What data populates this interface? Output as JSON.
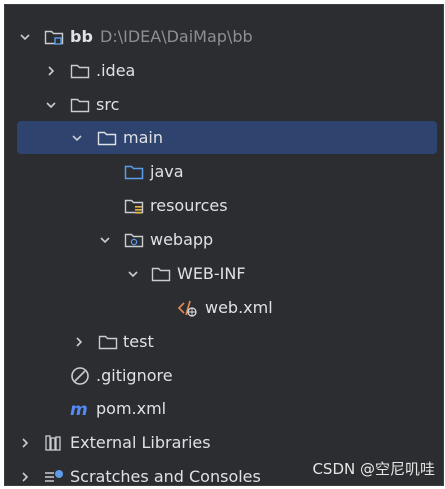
{
  "tree": {
    "root": {
      "label": "bb",
      "path": "D:\\IDEA\\DaiMap\\bb"
    },
    "idea": {
      "label": ".idea"
    },
    "src": {
      "label": "src"
    },
    "main": {
      "label": "main"
    },
    "java": {
      "label": "java"
    },
    "resources": {
      "label": "resources"
    },
    "webapp": {
      "label": "webapp"
    },
    "webinf": {
      "label": "WEB-INF"
    },
    "webxml": {
      "label": "web.xml"
    },
    "test": {
      "label": "test"
    },
    "gitignore": {
      "label": ".gitignore"
    },
    "pom": {
      "label": "pom.xml"
    },
    "external": {
      "label": "External Libraries"
    },
    "scratches": {
      "label": "Scratches and Consoles"
    }
  },
  "watermark": "CSDN @空尼叽哇",
  "colors": {
    "panel_bg": "#2b2d30",
    "selection": "#2e436e",
    "text": "#dfe1e5",
    "muted": "#8c8f94",
    "source_folder": "#5c9ceb",
    "maven_blue": "#548af7",
    "xml_orange": "#e08855"
  },
  "icons": {
    "folder": "folder-icon",
    "project": "project-folder-icon",
    "source": "source-folder-icon",
    "resources": "resources-folder-icon",
    "web": "web-folder-icon",
    "xml": "xml-file-icon",
    "ignore": "ignore-file-icon",
    "maven": "maven-file-icon",
    "library": "library-icon",
    "scratch": "scratches-icon"
  }
}
